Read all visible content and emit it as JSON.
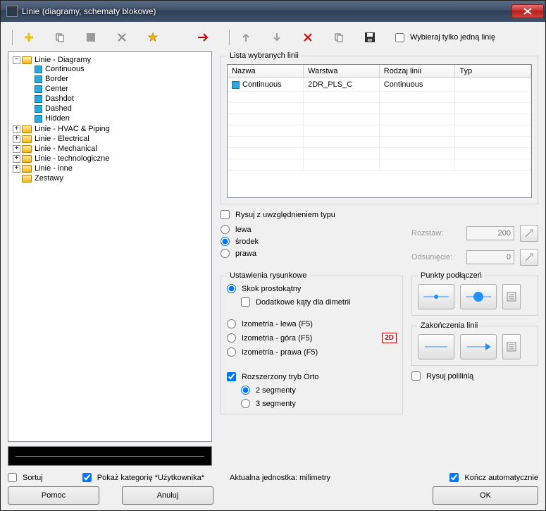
{
  "window": {
    "title": "Linie (diagramy, schematy blokowe)"
  },
  "checkbox_select_one": "Wybieraj tylko jedną linię",
  "tree": {
    "root": {
      "label": "Linie - Diagramy"
    },
    "leaves": [
      "Continuous",
      "Border",
      "Center",
      "Dashdot",
      "Dashed",
      "Hidden"
    ],
    "folders_closed": [
      "Linie - HVAC & Piping",
      "Linie - Electrical",
      "Linie - Mechanical",
      "Linie - technologiczne",
      "Linie - inne",
      "Zestawy"
    ]
  },
  "selected_list": {
    "legend": "Lista wybranych linii",
    "cols": [
      "Nazwa",
      "Warstwa",
      "Rodzaj linii",
      "Typ"
    ],
    "row": {
      "name": "Continuous",
      "layer": "2DR_PLS_C",
      "kind": "Continuous",
      "type": ""
    }
  },
  "draw_by_type": "Rysuj z uwzględnieniem typu",
  "align": {
    "lewa": "lewa",
    "srodek": "środek",
    "prawa": "prawa",
    "selected": "środek"
  },
  "spacing": {
    "label": "Rozstaw:",
    "value": "200"
  },
  "offset": {
    "label": "Odsunięcie:",
    "value": "0"
  },
  "drawing": {
    "legend": "Ustawienia rysunkowe",
    "ortho": "Skok prostokątny",
    "extra_angles": "Dodatkowe kąty dla dimetrii",
    "iso_left": "Izometria - lewa (F5)",
    "iso_top": "Izometria - góra (F5)",
    "iso_right": "Izometria - prawa (F5)",
    "badge": "2D",
    "ext_ortho": "Rozszerzony tryb Orto",
    "seg2": "2 segmenty",
    "seg3": "3 segmenty"
  },
  "conn_points": {
    "legend": "Punkty podłączeń"
  },
  "line_ends": {
    "legend": "Zakończenia linii"
  },
  "polyline": "Rysuj polilinią",
  "sort": "Sortuj",
  "show_user_cat": "Pokaż kategorię *Użytkownika*",
  "units": "Aktualna jednostka: milimetry",
  "auto_end": "Kończ automatycznie",
  "btns": {
    "help": "Pomoc",
    "cancel": "Anuluj",
    "ok": "OK"
  }
}
